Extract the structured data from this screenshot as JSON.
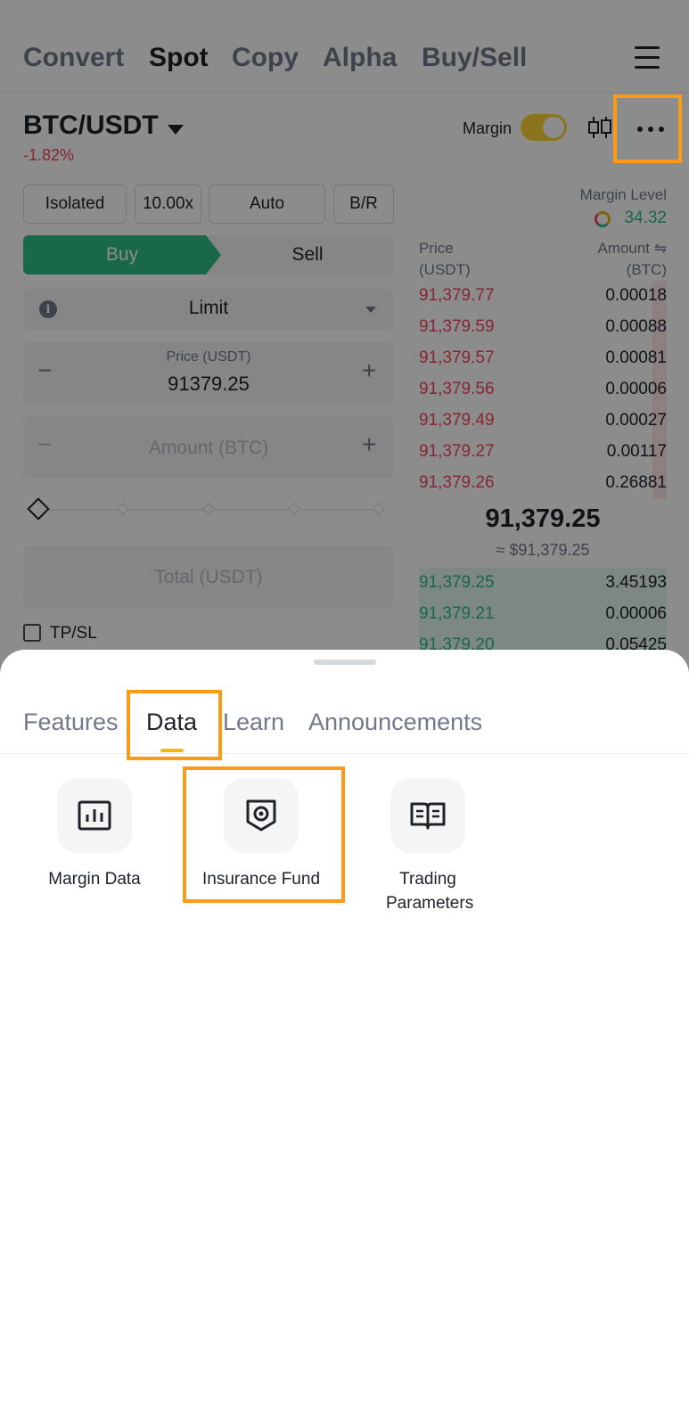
{
  "top_nav": {
    "tabs": [
      "Convert",
      "Spot",
      "Copy",
      "Alpha",
      "Buy/Sell"
    ],
    "active_tab": "Spot"
  },
  "pair": {
    "symbol": "BTC/USDT",
    "change": "-1.82%",
    "margin_label": "Margin",
    "margin_enabled": true
  },
  "order_form": {
    "mode": "Isolated",
    "leverage": "10.00x",
    "auto": "Auto",
    "br": "B/R",
    "buy_label": "Buy",
    "sell_label": "Sell",
    "order_type": "Limit",
    "price_label": "Price (USDT)",
    "price_value": "91379.25",
    "amount_placeholder": "Amount (BTC)",
    "total_placeholder": "Total (USDT)",
    "tpsl_label": "TP/SL",
    "plus": "+",
    "minus": "−",
    "info": "i"
  },
  "order_book": {
    "margin_level_label": "Margin Level",
    "margin_level_value": "34.32",
    "price_header_1": "Price",
    "price_header_2": "(USDT)",
    "amount_header_1": "Amount ⇋",
    "amount_header_2": "(BTC)",
    "asks": [
      {
        "price": "91,379.77",
        "amount": "0.00018"
      },
      {
        "price": "91,379.59",
        "amount": "0.00088"
      },
      {
        "price": "91,379.57",
        "amount": "0.00081"
      },
      {
        "price": "91,379.56",
        "amount": "0.00006"
      },
      {
        "price": "91,379.49",
        "amount": "0.00027"
      },
      {
        "price": "91,379.27",
        "amount": "0.00117"
      },
      {
        "price": "91,379.26",
        "amount": "0.26881"
      }
    ],
    "mid_price": "91,379.25",
    "mid_approx": "≈ $91,379.25",
    "bids": [
      {
        "price": "91,379.25",
        "amount": "3.45193"
      },
      {
        "price": "91,379.21",
        "amount": "0.00006"
      },
      {
        "price": "91,379.20",
        "amount": "0.05425"
      }
    ]
  },
  "sheet": {
    "tabs": [
      "Features",
      "Data",
      "Learn",
      "Announcements"
    ],
    "active_tab": "Data",
    "items": [
      {
        "label": "Margin Data",
        "icon": "bar-chart-icon"
      },
      {
        "label": "Insurance Fund",
        "icon": "shield-icon"
      },
      {
        "label": "Trading Parameters",
        "icon": "book-icon"
      }
    ]
  },
  "colors": {
    "accent": "#f0b90b",
    "buy": "#2ebd85",
    "sell": "#f6465d",
    "highlight": "#ff9a16"
  }
}
